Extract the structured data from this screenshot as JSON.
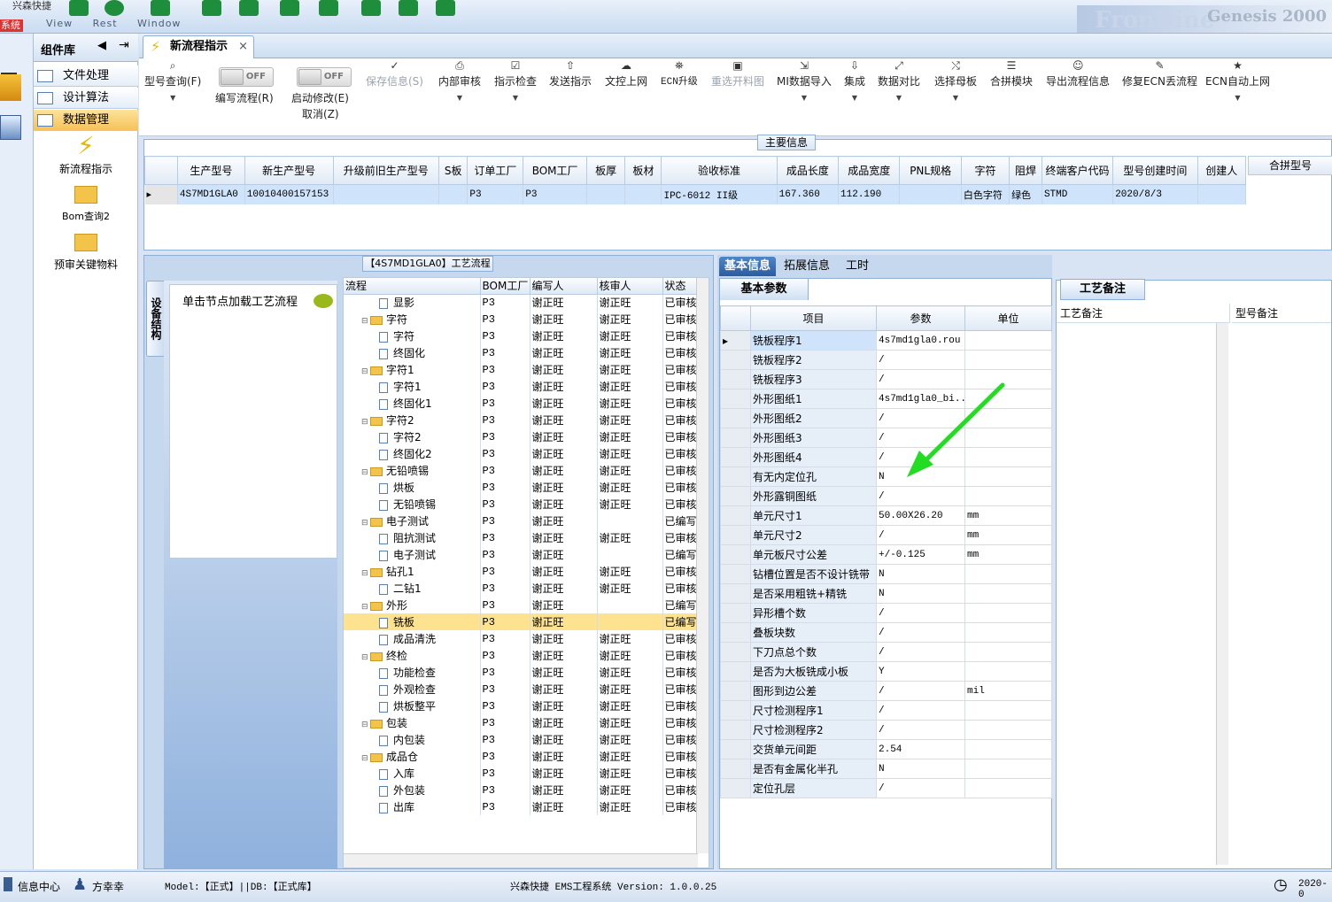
{
  "window": {
    "title": "兴森快捷",
    "system_tag": "系统",
    "bg_menu": [
      "View",
      "Rest",
      "Window"
    ],
    "brand": "Frontline",
    "brand_sub": "Genesis 2000"
  },
  "left_panel": {
    "title": "组件库",
    "sections": [
      "文件处理",
      "设计算法",
      "数据管理"
    ],
    "selected": "数据管理",
    "tools": [
      "新流程指示",
      "Bom查询2",
      "预审关键物料"
    ]
  },
  "tab": {
    "label": "新流程指示",
    "close": "×"
  },
  "toolbar": {
    "buttons": [
      {
        "label": "型号查询(F)",
        "icon": "search-icon",
        "dropdown": true
      },
      {
        "label": "编写流程(R)",
        "toggle": "OFF"
      },
      {
        "label": "启动修改(E)",
        "sub": "取消(Z)",
        "toggle": "OFF"
      },
      {
        "label": "保存信息(S)",
        "icon": "check-icon",
        "disabled": true
      },
      {
        "label": "内部审核",
        "icon": "printer-icon",
        "dropdown": true
      },
      {
        "label": "指示检查",
        "icon": "checkbox-icon",
        "dropdown": true
      },
      {
        "label": "发送指示",
        "icon": "upload-icon"
      },
      {
        "label": "文控上网",
        "icon": "cloud-upload-icon"
      },
      {
        "label": "ECN升级",
        "icon": "tag-icon"
      },
      {
        "label": "重选开料图",
        "icon": "image-icon",
        "disabled": true
      },
      {
        "label": "MI数据导入",
        "icon": "import-icon",
        "dropdown": true
      },
      {
        "label": "集成",
        "icon": "download-icon",
        "dropdown": true
      },
      {
        "label": "数据对比",
        "icon": "compare-icon",
        "dropdown": true
      },
      {
        "label": "选择母板",
        "icon": "shuffle-icon",
        "dropdown": true
      },
      {
        "label": "合拼模块",
        "icon": "list-icon"
      },
      {
        "label": "导出流程信息",
        "icon": "smiley-icon"
      },
      {
        "label": "修复ECN丢流程",
        "icon": "wrench-icon"
      },
      {
        "label": "ECN自动上网",
        "icon": "star-icon",
        "dropdown": true
      }
    ]
  },
  "main_info": {
    "title": "主要信息",
    "columns": [
      "生产型号",
      "新生产型号",
      "升级前旧生产型号",
      "S板",
      "订单工厂",
      "BOM工厂",
      "板厚",
      "板材",
      "验收标准",
      "成品长度",
      "成品宽度",
      "PNL规格",
      "字符",
      "阻焊",
      "终端客户代码",
      "型号创建时间",
      "创建人"
    ],
    "row": [
      "4S7MD1GLA0",
      "10010400157153",
      "",
      "",
      "P3",
      "P3",
      "",
      "",
      "IPC-6012 II级",
      "167.360",
      "112.190",
      "",
      "白色字符",
      "绿色",
      "STMD",
      "2020/8/3",
      ""
    ],
    "side_column": "合拼型号"
  },
  "flow": {
    "title": "【4S7MD1GLA0】工艺流程",
    "side_tab": "设备结构",
    "hint": "单击节点加载工艺流程",
    "columns": [
      "流程",
      "BOM工厂",
      "编写人",
      "核审人",
      "状态"
    ],
    "rows": [
      {
        "name": "显影",
        "level": 2,
        "type": "doc",
        "bom": "P3",
        "writer": "谢正旺",
        "reviewer": "谢正旺",
        "status": "已审核"
      },
      {
        "name": "字符",
        "level": 1,
        "type": "folder",
        "bom": "P3",
        "writer": "谢正旺",
        "reviewer": "谢正旺",
        "status": "已审核"
      },
      {
        "name": "字符",
        "level": 2,
        "type": "doc",
        "bom": "P3",
        "writer": "谢正旺",
        "reviewer": "谢正旺",
        "status": "已审核"
      },
      {
        "name": "终固化",
        "level": 2,
        "type": "doc",
        "bom": "P3",
        "writer": "谢正旺",
        "reviewer": "谢正旺",
        "status": "已审核"
      },
      {
        "name": "字符1",
        "level": 1,
        "type": "folder",
        "bom": "P3",
        "writer": "谢正旺",
        "reviewer": "谢正旺",
        "status": "已审核"
      },
      {
        "name": "字符1",
        "level": 2,
        "type": "doc",
        "bom": "P3",
        "writer": "谢正旺",
        "reviewer": "谢正旺",
        "status": "已审核"
      },
      {
        "name": "终固化1",
        "level": 2,
        "type": "doc",
        "bom": "P3",
        "writer": "谢正旺",
        "reviewer": "谢正旺",
        "status": "已审核"
      },
      {
        "name": "字符2",
        "level": 1,
        "type": "folder",
        "bom": "P3",
        "writer": "谢正旺",
        "reviewer": "谢正旺",
        "status": "已审核"
      },
      {
        "name": "字符2",
        "level": 2,
        "type": "doc",
        "bom": "P3",
        "writer": "谢正旺",
        "reviewer": "谢正旺",
        "status": "已审核"
      },
      {
        "name": "终固化2",
        "level": 2,
        "type": "doc",
        "bom": "P3",
        "writer": "谢正旺",
        "reviewer": "谢正旺",
        "status": "已审核"
      },
      {
        "name": "无铅喷锡",
        "level": 1,
        "type": "folder",
        "bom": "P3",
        "writer": "谢正旺",
        "reviewer": "谢正旺",
        "status": "已审核"
      },
      {
        "name": "烘板",
        "level": 2,
        "type": "doc",
        "bom": "P3",
        "writer": "谢正旺",
        "reviewer": "谢正旺",
        "status": "已审核"
      },
      {
        "name": "无铅喷锡",
        "level": 2,
        "type": "doc",
        "bom": "P3",
        "writer": "谢正旺",
        "reviewer": "谢正旺",
        "status": "已审核"
      },
      {
        "name": "电子测试",
        "level": 1,
        "type": "folder",
        "bom": "P3",
        "writer": "谢正旺",
        "reviewer": "",
        "status": "已编写"
      },
      {
        "name": "阻抗测试",
        "level": 2,
        "type": "doc",
        "bom": "P3",
        "writer": "谢正旺",
        "reviewer": "谢正旺",
        "status": "已审核"
      },
      {
        "name": "电子测试",
        "level": 2,
        "type": "doc",
        "bom": "P3",
        "writer": "谢正旺",
        "reviewer": "",
        "status": "已编写"
      },
      {
        "name": "钻孔1",
        "level": 1,
        "type": "folder",
        "bom": "P3",
        "writer": "谢正旺",
        "reviewer": "谢正旺",
        "status": "已审核"
      },
      {
        "name": "二钻1",
        "level": 2,
        "type": "doc",
        "bom": "P3",
        "writer": "谢正旺",
        "reviewer": "谢正旺",
        "status": "已审核"
      },
      {
        "name": "外形",
        "level": 1,
        "type": "folder",
        "bom": "P3",
        "writer": "谢正旺",
        "reviewer": "",
        "status": "已编写"
      },
      {
        "name": "铣板",
        "level": 2,
        "type": "doc",
        "bom": "P3",
        "writer": "谢正旺",
        "reviewer": "",
        "status": "已编写",
        "selected": true
      },
      {
        "name": "成品清洗",
        "level": 2,
        "type": "doc",
        "bom": "P3",
        "writer": "谢正旺",
        "reviewer": "谢正旺",
        "status": "已审核"
      },
      {
        "name": "终检",
        "level": 1,
        "type": "folder",
        "bom": "P3",
        "writer": "谢正旺",
        "reviewer": "谢正旺",
        "status": "已审核"
      },
      {
        "name": "功能检查",
        "level": 2,
        "type": "doc",
        "bom": "P3",
        "writer": "谢正旺",
        "reviewer": "谢正旺",
        "status": "已审核"
      },
      {
        "name": "外观检查",
        "level": 2,
        "type": "doc",
        "bom": "P3",
        "writer": "谢正旺",
        "reviewer": "谢正旺",
        "status": "已审核"
      },
      {
        "name": "烘板整平",
        "level": 2,
        "type": "doc",
        "bom": "P3",
        "writer": "谢正旺",
        "reviewer": "谢正旺",
        "status": "已审核"
      },
      {
        "name": "包装",
        "level": 1,
        "type": "folder",
        "bom": "P3",
        "writer": "谢正旺",
        "reviewer": "谢正旺",
        "status": "已审核"
      },
      {
        "name": "内包装",
        "level": 2,
        "type": "doc",
        "bom": "P3",
        "writer": "谢正旺",
        "reviewer": "谢正旺",
        "status": "已审核"
      },
      {
        "name": "成品仓",
        "level": 1,
        "type": "folder",
        "bom": "P3",
        "writer": "谢正旺",
        "reviewer": "谢正旺",
        "status": "已审核"
      },
      {
        "name": "入库",
        "level": 2,
        "type": "doc",
        "bom": "P3",
        "writer": "谢正旺",
        "reviewer": "谢正旺",
        "status": "已审核"
      },
      {
        "name": "外包装",
        "level": 2,
        "type": "doc",
        "bom": "P3",
        "writer": "谢正旺",
        "reviewer": "谢正旺",
        "status": "已审核"
      },
      {
        "name": "出库",
        "level": 2,
        "type": "doc",
        "bom": "P3",
        "writer": "谢正旺",
        "reviewer": "谢正旺",
        "status": "已审核"
      }
    ]
  },
  "detail": {
    "tabs": [
      "基本信息",
      "拓展信息",
      "工时"
    ],
    "section": "基本参数",
    "columns": [
      "项目",
      "参数",
      "单位"
    ],
    "rows": [
      {
        "item": "铣板程序1",
        "value": "4s7md1gla0.rou",
        "unit": ""
      },
      {
        "item": "铣板程序2",
        "value": "/",
        "unit": ""
      },
      {
        "item": "铣板程序3",
        "value": "/",
        "unit": ""
      },
      {
        "item": "外形图纸1",
        "value": "4s7md1gla0_bi...",
        "unit": ""
      },
      {
        "item": "外形图纸2",
        "value": "/",
        "unit": ""
      },
      {
        "item": "外形图纸3",
        "value": "/",
        "unit": ""
      },
      {
        "item": "外形图纸4",
        "value": "/",
        "unit": ""
      },
      {
        "item": "有无内定位孔",
        "value": "N",
        "unit": ""
      },
      {
        "item": "外形露铜图纸",
        "value": "/",
        "unit": ""
      },
      {
        "item": "单元尺寸1",
        "value": "50.00X26.20",
        "unit": "mm"
      },
      {
        "item": "单元尺寸2",
        "value": "/",
        "unit": "mm"
      },
      {
        "item": "单元板尺寸公差",
        "value": "+/-0.125",
        "unit": "mm"
      },
      {
        "item": "钻槽位置是否不设计铣带",
        "value": "N",
        "unit": ""
      },
      {
        "item": "是否采用粗铣+精铣",
        "value": "N",
        "unit": ""
      },
      {
        "item": "异形槽个数",
        "value": "/",
        "unit": ""
      },
      {
        "item": "叠板块数",
        "value": "/",
        "unit": ""
      },
      {
        "item": "下刀点总个数",
        "value": "/",
        "unit": ""
      },
      {
        "item": "是否为大板铣成小板",
        "value": "Y",
        "unit": ""
      },
      {
        "item": "图形到边公差",
        "value": "/",
        "unit": "mil"
      },
      {
        "item": "尺寸检测程序1",
        "value": "/",
        "unit": ""
      },
      {
        "item": "尺寸检测程序2",
        "value": "/",
        "unit": ""
      },
      {
        "item": "交货单元间距",
        "value": "2.54",
        "unit": ""
      },
      {
        "item": "是否有金属化半孔",
        "value": "N",
        "unit": ""
      },
      {
        "item": "定位孔层",
        "value": "/",
        "unit": ""
      }
    ]
  },
  "notes": {
    "section": "工艺备注",
    "columns": [
      "工艺备注",
      "型号备注"
    ]
  },
  "status_bar": {
    "info_center": "信息中心",
    "user": "方幸幸",
    "model": "Model:【正式】||DB:【正式库】",
    "app": "兴森快捷 EMS工程系统 Version: 1.0.0.25",
    "time": "2020-0"
  },
  "colors": {
    "highlight_row": "#fde28f",
    "selected_row": "#cfe3fb",
    "annotation_arrow": "#22dd22"
  }
}
